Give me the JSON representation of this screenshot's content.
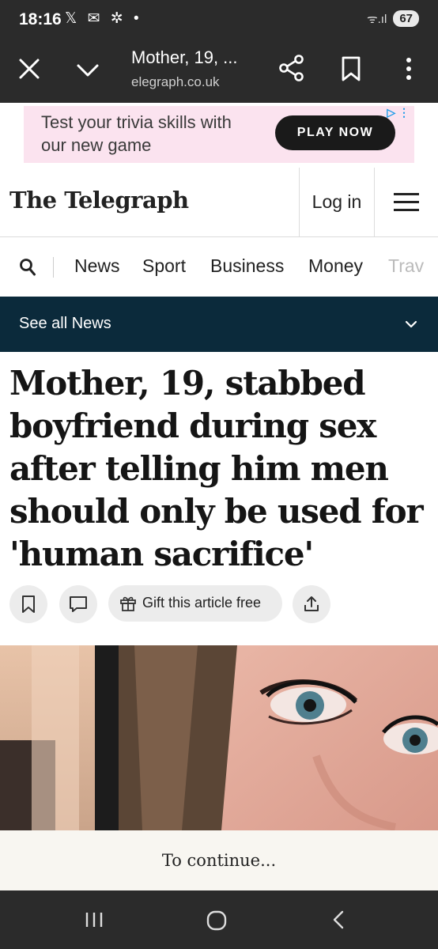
{
  "status_bar": {
    "time": "18:16",
    "notification_icons": "𝕏 ✉ ✲ •",
    "signal": "ᯤ.ıl",
    "battery": "67"
  },
  "browser": {
    "close_icon": "close-icon",
    "title": "Mother, 19, ...",
    "url": "elegraph.co.uk",
    "share_icon": "share-icon",
    "bookmark_icon": "bookmark-icon",
    "more_icon": "more-vert-icon"
  },
  "ad": {
    "text": "Test your trivia skills with our new game",
    "button": "PLAY NOW",
    "choices": "▷ ⋮"
  },
  "masthead": {
    "logo": "The Telegraph",
    "login": "Log in"
  },
  "nav": {
    "items": [
      "News",
      "Sport",
      "Business",
      "Money",
      "Trav"
    ]
  },
  "section_bar": {
    "label": "See all News"
  },
  "article": {
    "headline": "Mother, 19, stabbed boyfriend during sex after telling him men should only be used for 'human sacrifice'",
    "gift_label": "Gift this article free"
  },
  "paywall": {
    "continue_label": "To continue..."
  },
  "colors": {
    "status_bg": "#2b2b2b",
    "section_bar_bg": "#0b2a3b",
    "ad_bg": "#fbe3ef",
    "continue_bg": "#f8f6f1"
  }
}
